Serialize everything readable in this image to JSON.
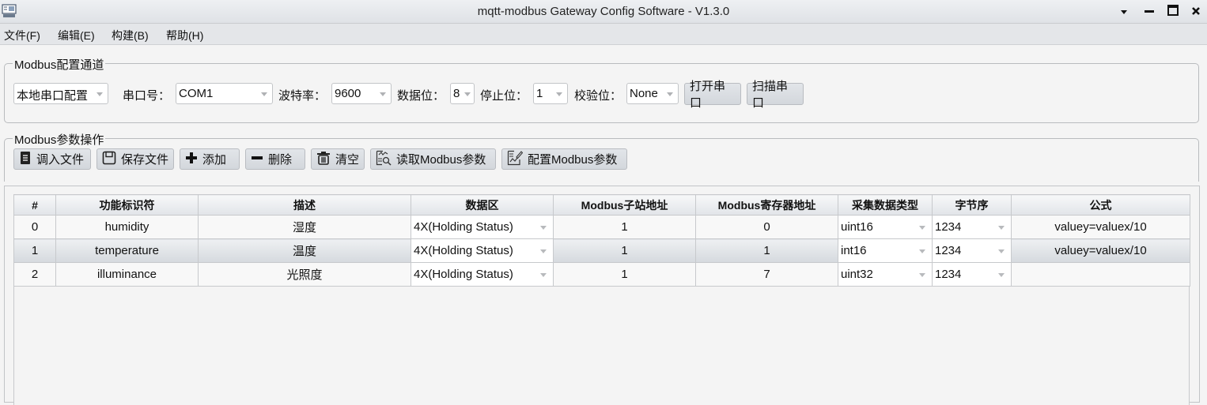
{
  "window": {
    "title": "mqtt-modbus Gateway Config Software - V1.3.0",
    "controls": [
      "dropdown",
      "minimize",
      "maximize",
      "close"
    ]
  },
  "menu": [
    {
      "label": "文件(F)"
    },
    {
      "label": "编辑(E)"
    },
    {
      "label": "构建(B)"
    },
    {
      "label": "帮助(H)"
    }
  ],
  "channel_group": {
    "title": "Modbus配置通道",
    "mode": "本地串口配置",
    "port_label": "串口号：",
    "port": "COM1",
    "baud_label": "波特率：",
    "baud": "9600",
    "databits_label": "数据位：",
    "databits": "8",
    "stopbits_label": "停止位：",
    "stopbits": "1",
    "parity_label": "校验位：",
    "parity": "None",
    "open_button": "打开串口",
    "scan_button": "扫描串口"
  },
  "ops_group": {
    "title": "Modbus参数操作",
    "buttons": [
      {
        "label": "调入文件",
        "icon": "file-import-icon"
      },
      {
        "label": "保存文件",
        "icon": "save-icon"
      },
      {
        "label": "添加",
        "icon": "plus-icon"
      },
      {
        "label": "删除",
        "icon": "minus-icon"
      },
      {
        "label": "清空",
        "icon": "trash-icon"
      },
      {
        "label": "读取Modbus参数",
        "icon": "read-params-icon"
      },
      {
        "label": "配置Modbus参数",
        "icon": "write-params-icon"
      }
    ]
  },
  "table": {
    "columns": [
      "#",
      "功能标识符",
      "描述",
      "数据区",
      "Modbus子站地址",
      "Modbus寄存器地址",
      "采集数据类型",
      "字节序",
      "公式"
    ],
    "rows": [
      {
        "index": "0",
        "id": "humidity",
        "desc": "湿度",
        "area": "4X(Holding Status)",
        "slave": "1",
        "reg": "0",
        "dtype": "uint16",
        "order": "1234",
        "formula": "valuey=valuex/10",
        "selected": false
      },
      {
        "index": "1",
        "id": "temperature",
        "desc": "温度",
        "area": "4X(Holding Status)",
        "slave": "1",
        "reg": "1",
        "dtype": "int16",
        "order": "1234",
        "formula": "valuey=valuex/10",
        "selected": true
      },
      {
        "index": "2",
        "id": "illuminance",
        "desc": "光照度",
        "area": "4X(Holding Status)",
        "slave": "1",
        "reg": "7",
        "dtype": "uint32",
        "order": "1234",
        "formula": "",
        "selected": false
      }
    ]
  }
}
